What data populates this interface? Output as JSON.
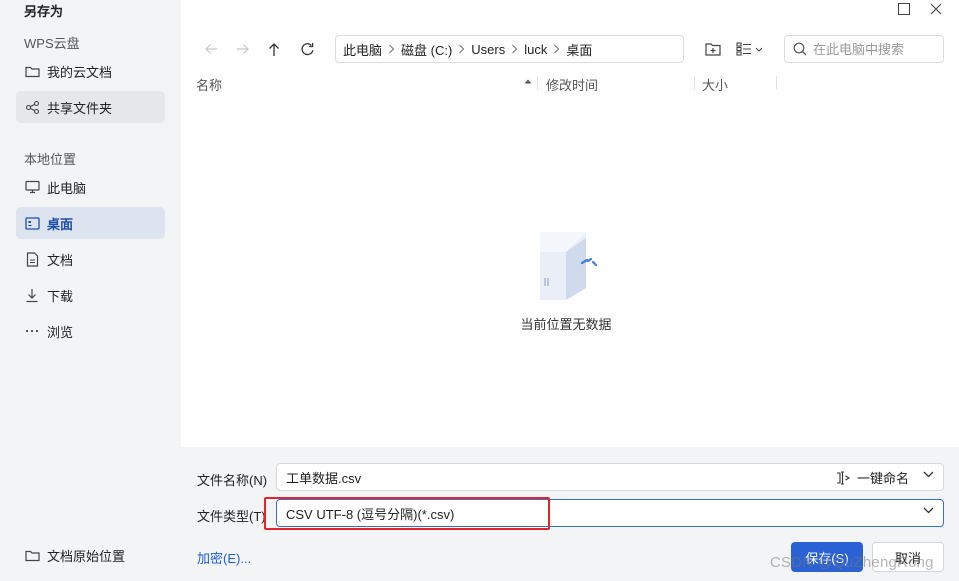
{
  "dialog": {
    "title": "另存为"
  },
  "sidebar": {
    "cloud_section": "WPS云盘",
    "cloud_items": [
      {
        "label": "我的云文档",
        "icon": "folder-icon"
      },
      {
        "label": "共享文件夹",
        "icon": "share-icon"
      }
    ],
    "local_section": "本地位置",
    "local_items": [
      {
        "label": "此电脑",
        "icon": "monitor-icon"
      },
      {
        "label": "桌面",
        "icon": "desktop-icon"
      },
      {
        "label": "文档",
        "icon": "document-icon"
      },
      {
        "label": "下载",
        "icon": "download-icon"
      },
      {
        "label": "浏览",
        "icon": "more-icon"
      }
    ],
    "original_location": "文档原始位置"
  },
  "breadcrumb": [
    "此电脑",
    "磁盘 (C:)",
    "Users",
    "luck",
    "桌面"
  ],
  "search": {
    "placeholder": "在此电脑中搜索"
  },
  "columns": {
    "name": "名称",
    "modified": "修改时间",
    "size": "大小"
  },
  "empty": {
    "message": "当前位置无数据"
  },
  "form": {
    "filename_label": "文件名称(N)",
    "filename_value": "工单数据.csv",
    "onekey_label": "一键命名",
    "filetype_label": "文件类型(T)",
    "filetype_value": "CSV UTF-8 (逗号分隔)(*.csv)"
  },
  "actions": {
    "encrypt": "加密(E)...",
    "save": "保存(S)",
    "cancel": "取消"
  },
  "watermark": "CSDN @QuZhengRong",
  "colors": {
    "accent": "#2a62d6",
    "highlight_box": "#e3242b",
    "sidebar_bg": "#f3f4f6",
    "active_item_bg": "#dde4f0"
  }
}
